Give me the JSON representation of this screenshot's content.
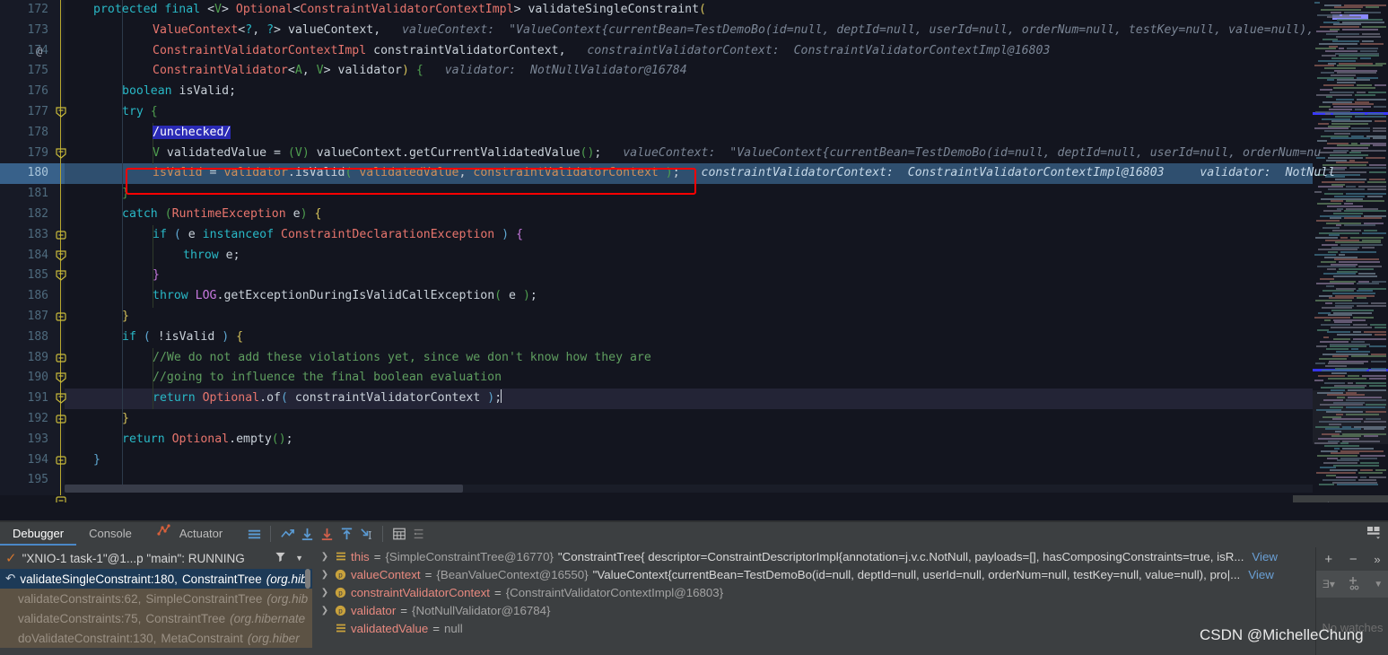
{
  "editor": {
    "first_line": 172,
    "exec_line": 180,
    "caret_line": 191,
    "lines": [
      {
        "n": 172,
        "at": true
      },
      {
        "n": 173
      },
      {
        "n": 174
      },
      {
        "n": 175,
        "fold": "start"
      },
      {
        "n": 176
      },
      {
        "n": 177,
        "fold": "start"
      },
      {
        "n": 178
      },
      {
        "n": 179
      },
      {
        "n": 180,
        "exec": true
      },
      {
        "n": 181,
        "fold": "end"
      },
      {
        "n": 182,
        "fold": "start"
      },
      {
        "n": 183,
        "fold": "start"
      },
      {
        "n": 184
      },
      {
        "n": 185,
        "fold": "end"
      },
      {
        "n": 186
      },
      {
        "n": 187,
        "fold": "end"
      },
      {
        "n": 188,
        "fold": "start"
      },
      {
        "n": 189,
        "fold": "start"
      },
      {
        "n": 190,
        "fold": "end"
      },
      {
        "n": 191,
        "current": true
      },
      {
        "n": 192,
        "fold": "end"
      },
      {
        "n": 193
      },
      {
        "n": 194,
        "fold": "end"
      },
      {
        "n": 195
      }
    ],
    "code_text": {
      "l172": "protected final <V> Optional<ConstraintValidatorContextImpl> validateSingleConstraint(",
      "l173": "ValueContext<?, ?> valueContext,",
      "l173_hint": "valueContext:  \"ValueContext{currentBean=TestDemoBo(id=null, deptId=null, userId=null, orderNum=null, testKey=null, value=null),",
      "l174": "ConstraintValidatorContextImpl constraintValidatorContext,",
      "l174_hint": "constraintValidatorContext:  ConstraintValidatorContextImpl@16803",
      "l175": "ConstraintValidator<A, V> validator) {",
      "l175_hint": "validator:  NotNullValidator@16784",
      "l176": "boolean isValid;",
      "l177": "try {",
      "l178": "/unchecked/",
      "l179": "V validatedValue = (V) valueContext.getCurrentValidatedValue();",
      "l179_hint": "valueContext:  \"ValueContext{currentBean=TestDemoBo(id=null, deptId=null, userId=null, orderNum=nu",
      "l180": "isValid = validator.isValid( validatedValue, constraintValidatorContext );",
      "l180_hint": "constraintValidatorContext:  ConstraintValidatorContextImpl@16803      validator:  NotNull",
      "l181": "}",
      "l182": "catch (RuntimeException e) {",
      "l183": "if ( e instanceof ConstraintDeclarationException ) {",
      "l184": "throw e;",
      "l185": "}",
      "l186": "throw LOG.getExceptionDuringIsValidCallException( e );",
      "l187": "}",
      "l188": "if ( !isValid ) {",
      "l189": "//We do not add these violations yet, since we don't know how they are",
      "l190": "//going to influence the final boolean evaluation",
      "l191": "return Optional.of( constraintValidatorContext );",
      "l192": "}",
      "l193": "return Optional.empty();",
      "l194": "}"
    }
  },
  "debug_panel": {
    "tabs": [
      {
        "id": "debugger",
        "label": "Debugger",
        "active": true
      },
      {
        "id": "console",
        "label": "Console",
        "active": false
      },
      {
        "id": "actuator",
        "label": "Actuator",
        "active": false,
        "icon": "actuator-icon"
      }
    ],
    "toolbar_icons": [
      "menu-icon",
      "show-execution-point-icon",
      "step-over-icon",
      "step-into-icon",
      "step-out-icon",
      "run-to-cursor-icon",
      "evaluate-expression-icon",
      "settings-list-icon"
    ],
    "thread": {
      "status_icon": "check-icon",
      "label": "\"XNIO-1 task-1\"@1...p \"main\": RUNNING",
      "filter_icon": "filter-icon",
      "dropdown_icon": "chevron-down-icon"
    },
    "frames": [
      {
        "method": "validateSingleConstraint:180,",
        "cls": "ConstraintTree",
        "pkg": "(org.hib",
        "selected": true,
        "icon": "return-arrow-icon"
      },
      {
        "method": "validateConstraints:62,",
        "cls": "SimpleConstraintTree",
        "pkg": "(org.hib",
        "selected": false,
        "lib": true
      },
      {
        "method": "validateConstraints:75,",
        "cls": "ConstraintTree",
        "pkg": "(org.hibernate",
        "selected": false,
        "lib": true
      },
      {
        "method": "doValidateConstraint:130,",
        "cls": "MetaConstraint",
        "pkg": "(org.hiber",
        "selected": false,
        "lib": true
      }
    ],
    "variables": [
      {
        "expandable": true,
        "icon": "field-icon",
        "name": "this",
        "eq": "=",
        "type": "{SimpleConstraintTree@16770}",
        "value": "\"ConstraintTree{ descriptor=ConstraintDescriptorImpl{annotation=j.v.c.NotNull, payloads=[], hasComposingConstraints=true, isR...",
        "view": "View"
      },
      {
        "expandable": true,
        "icon": "parameter-icon",
        "name": "valueContext",
        "eq": "=",
        "type": "{BeanValueContext@16550}",
        "value": "\"ValueContext{currentBean=TestDemoBo(id=null, deptId=null, userId=null, orderNum=null, testKey=null, value=null), pro|...",
        "view": "View"
      },
      {
        "expandable": true,
        "icon": "parameter-icon",
        "name": "constraintValidatorContext",
        "eq": "=",
        "type": "{ConstraintValidatorContextImpl@16803}",
        "value": "",
        "view": ""
      },
      {
        "expandable": true,
        "icon": "parameter-icon",
        "name": "validator",
        "eq": "=",
        "type": "{NotNullValidator@16784}",
        "value": "",
        "view": ""
      },
      {
        "expandable": false,
        "icon": "field-icon",
        "name": "validatedValue",
        "eq": "=",
        "type": "null",
        "value": "",
        "view": ""
      }
    ],
    "watches": {
      "add_label": "+",
      "remove_label": "−",
      "more_label": "»",
      "empty_text": "No watches",
      "group_icon": "group-by-icon",
      "add_watch_icon": "add-watch-icon",
      "dropdown_icon": "chevron-down-icon"
    }
  },
  "editor_footer": {
    "icons": [
      "inspections-icon",
      "settings-gear-icon",
      "minimize-icon"
    ]
  },
  "watermark": {
    "text": "CSDN @MichelleChung"
  },
  "colors": {
    "editor_bg": "#13151f",
    "gutter_bg": "#171a26",
    "exec_line_bg": "#2f4f6f",
    "current_line_bg": "#232436",
    "exec_box_border": "#ff0000",
    "keyword": "#29b8c6",
    "classname": "#e8756d",
    "comment": "#5f9e5f",
    "panel_bg": "#3c3f41",
    "selected_frame_bg": "#1d3a57",
    "lib_frame_bg": "#5c5244"
  }
}
